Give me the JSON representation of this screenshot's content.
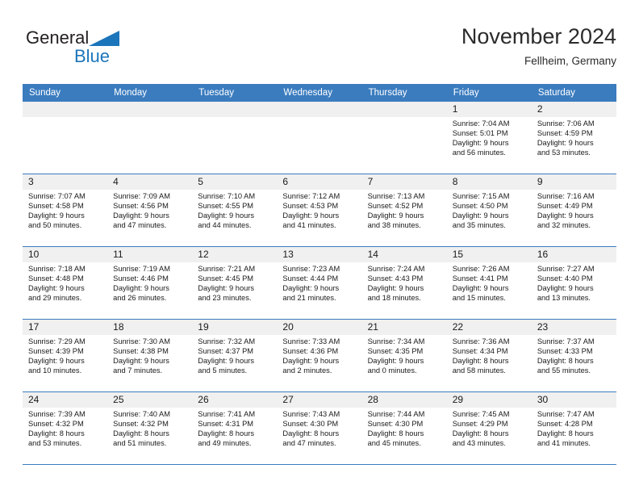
{
  "brand": {
    "word1": "General",
    "word2": "Blue",
    "triangle_color": "#1b75bb",
    "word2_color": "#1b75bb",
    "word1_color": "#231f20"
  },
  "header": {
    "title": "November 2024",
    "location": "Fellheim, Germany"
  },
  "theme": {
    "header_blue": "#3b7cbf",
    "daynum_band": "#f0f0f0",
    "cell_background": "#ffffff",
    "row_divider": "#3b7cbf"
  },
  "weekday_headers": [
    "Sunday",
    "Monday",
    "Tuesday",
    "Wednesday",
    "Thursday",
    "Friday",
    "Saturday"
  ],
  "weeks": [
    [
      {
        "day": "",
        "sunrise": "",
        "sunset": "",
        "daylight_line1": "",
        "daylight_line2": ""
      },
      {
        "day": "",
        "sunrise": "",
        "sunset": "",
        "daylight_line1": "",
        "daylight_line2": ""
      },
      {
        "day": "",
        "sunrise": "",
        "sunset": "",
        "daylight_line1": "",
        "daylight_line2": ""
      },
      {
        "day": "",
        "sunrise": "",
        "sunset": "",
        "daylight_line1": "",
        "daylight_line2": ""
      },
      {
        "day": "",
        "sunrise": "",
        "sunset": "",
        "daylight_line1": "",
        "daylight_line2": ""
      },
      {
        "day": "1",
        "sunrise": "Sunrise: 7:04 AM",
        "sunset": "Sunset: 5:01 PM",
        "daylight_line1": "Daylight: 9 hours",
        "daylight_line2": "and 56 minutes."
      },
      {
        "day": "2",
        "sunrise": "Sunrise: 7:06 AM",
        "sunset": "Sunset: 4:59 PM",
        "daylight_line1": "Daylight: 9 hours",
        "daylight_line2": "and 53 minutes."
      }
    ],
    [
      {
        "day": "3",
        "sunrise": "Sunrise: 7:07 AM",
        "sunset": "Sunset: 4:58 PM",
        "daylight_line1": "Daylight: 9 hours",
        "daylight_line2": "and 50 minutes."
      },
      {
        "day": "4",
        "sunrise": "Sunrise: 7:09 AM",
        "sunset": "Sunset: 4:56 PM",
        "daylight_line1": "Daylight: 9 hours",
        "daylight_line2": "and 47 minutes."
      },
      {
        "day": "5",
        "sunrise": "Sunrise: 7:10 AM",
        "sunset": "Sunset: 4:55 PM",
        "daylight_line1": "Daylight: 9 hours",
        "daylight_line2": "and 44 minutes."
      },
      {
        "day": "6",
        "sunrise": "Sunrise: 7:12 AM",
        "sunset": "Sunset: 4:53 PM",
        "daylight_line1": "Daylight: 9 hours",
        "daylight_line2": "and 41 minutes."
      },
      {
        "day": "7",
        "sunrise": "Sunrise: 7:13 AM",
        "sunset": "Sunset: 4:52 PM",
        "daylight_line1": "Daylight: 9 hours",
        "daylight_line2": "and 38 minutes."
      },
      {
        "day": "8",
        "sunrise": "Sunrise: 7:15 AM",
        "sunset": "Sunset: 4:50 PM",
        "daylight_line1": "Daylight: 9 hours",
        "daylight_line2": "and 35 minutes."
      },
      {
        "day": "9",
        "sunrise": "Sunrise: 7:16 AM",
        "sunset": "Sunset: 4:49 PM",
        "daylight_line1": "Daylight: 9 hours",
        "daylight_line2": "and 32 minutes."
      }
    ],
    [
      {
        "day": "10",
        "sunrise": "Sunrise: 7:18 AM",
        "sunset": "Sunset: 4:48 PM",
        "daylight_line1": "Daylight: 9 hours",
        "daylight_line2": "and 29 minutes."
      },
      {
        "day": "11",
        "sunrise": "Sunrise: 7:19 AM",
        "sunset": "Sunset: 4:46 PM",
        "daylight_line1": "Daylight: 9 hours",
        "daylight_line2": "and 26 minutes."
      },
      {
        "day": "12",
        "sunrise": "Sunrise: 7:21 AM",
        "sunset": "Sunset: 4:45 PM",
        "daylight_line1": "Daylight: 9 hours",
        "daylight_line2": "and 23 minutes."
      },
      {
        "day": "13",
        "sunrise": "Sunrise: 7:23 AM",
        "sunset": "Sunset: 4:44 PM",
        "daylight_line1": "Daylight: 9 hours",
        "daylight_line2": "and 21 minutes."
      },
      {
        "day": "14",
        "sunrise": "Sunrise: 7:24 AM",
        "sunset": "Sunset: 4:43 PM",
        "daylight_line1": "Daylight: 9 hours",
        "daylight_line2": "and 18 minutes."
      },
      {
        "day": "15",
        "sunrise": "Sunrise: 7:26 AM",
        "sunset": "Sunset: 4:41 PM",
        "daylight_line1": "Daylight: 9 hours",
        "daylight_line2": "and 15 minutes."
      },
      {
        "day": "16",
        "sunrise": "Sunrise: 7:27 AM",
        "sunset": "Sunset: 4:40 PM",
        "daylight_line1": "Daylight: 9 hours",
        "daylight_line2": "and 13 minutes."
      }
    ],
    [
      {
        "day": "17",
        "sunrise": "Sunrise: 7:29 AM",
        "sunset": "Sunset: 4:39 PM",
        "daylight_line1": "Daylight: 9 hours",
        "daylight_line2": "and 10 minutes."
      },
      {
        "day": "18",
        "sunrise": "Sunrise: 7:30 AM",
        "sunset": "Sunset: 4:38 PM",
        "daylight_line1": "Daylight: 9 hours",
        "daylight_line2": "and 7 minutes."
      },
      {
        "day": "19",
        "sunrise": "Sunrise: 7:32 AM",
        "sunset": "Sunset: 4:37 PM",
        "daylight_line1": "Daylight: 9 hours",
        "daylight_line2": "and 5 minutes."
      },
      {
        "day": "20",
        "sunrise": "Sunrise: 7:33 AM",
        "sunset": "Sunset: 4:36 PM",
        "daylight_line1": "Daylight: 9 hours",
        "daylight_line2": "and 2 minutes."
      },
      {
        "day": "21",
        "sunrise": "Sunrise: 7:34 AM",
        "sunset": "Sunset: 4:35 PM",
        "daylight_line1": "Daylight: 9 hours",
        "daylight_line2": "and 0 minutes."
      },
      {
        "day": "22",
        "sunrise": "Sunrise: 7:36 AM",
        "sunset": "Sunset: 4:34 PM",
        "daylight_line1": "Daylight: 8 hours",
        "daylight_line2": "and 58 minutes."
      },
      {
        "day": "23",
        "sunrise": "Sunrise: 7:37 AM",
        "sunset": "Sunset: 4:33 PM",
        "daylight_line1": "Daylight: 8 hours",
        "daylight_line2": "and 55 minutes."
      }
    ],
    [
      {
        "day": "24",
        "sunrise": "Sunrise: 7:39 AM",
        "sunset": "Sunset: 4:32 PM",
        "daylight_line1": "Daylight: 8 hours",
        "daylight_line2": "and 53 minutes."
      },
      {
        "day": "25",
        "sunrise": "Sunrise: 7:40 AM",
        "sunset": "Sunset: 4:32 PM",
        "daylight_line1": "Daylight: 8 hours",
        "daylight_line2": "and 51 minutes."
      },
      {
        "day": "26",
        "sunrise": "Sunrise: 7:41 AM",
        "sunset": "Sunset: 4:31 PM",
        "daylight_line1": "Daylight: 8 hours",
        "daylight_line2": "and 49 minutes."
      },
      {
        "day": "27",
        "sunrise": "Sunrise: 7:43 AM",
        "sunset": "Sunset: 4:30 PM",
        "daylight_line1": "Daylight: 8 hours",
        "daylight_line2": "and 47 minutes."
      },
      {
        "day": "28",
        "sunrise": "Sunrise: 7:44 AM",
        "sunset": "Sunset: 4:30 PM",
        "daylight_line1": "Daylight: 8 hours",
        "daylight_line2": "and 45 minutes."
      },
      {
        "day": "29",
        "sunrise": "Sunrise: 7:45 AM",
        "sunset": "Sunset: 4:29 PM",
        "daylight_line1": "Daylight: 8 hours",
        "daylight_line2": "and 43 minutes."
      },
      {
        "day": "30",
        "sunrise": "Sunrise: 7:47 AM",
        "sunset": "Sunset: 4:28 PM",
        "daylight_line1": "Daylight: 8 hours",
        "daylight_line2": "and 41 minutes."
      }
    ]
  ]
}
